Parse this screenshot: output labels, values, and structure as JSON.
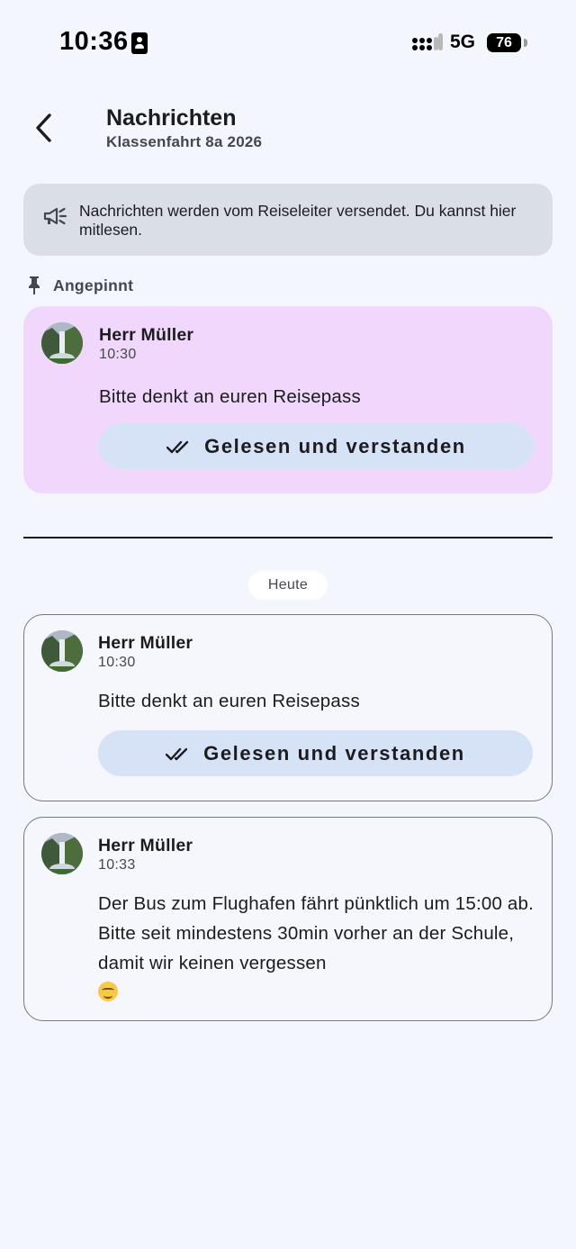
{
  "status_bar": {
    "time": "10:36",
    "network": "5G",
    "battery": "76",
    "icons": [
      "id-card-icon",
      "signal-icon",
      "battery-icon"
    ]
  },
  "header": {
    "title": "Nachrichten",
    "subtitle": "Klassenfahrt 8a 2026",
    "back_icon": "chevron-left-icon"
  },
  "info_banner": {
    "icon": "megaphone-icon",
    "text": "Nachrichten werden vom Reiseleiter versendet. Du kannst hier mitlesen."
  },
  "pinned": {
    "label": "Angepinnt",
    "icon": "pin-icon",
    "message": {
      "sender": "Herr Müller",
      "time": "10:30",
      "text": "Bitte denkt an euren Reisepass",
      "ack_label": "Gelesen und verstanden"
    }
  },
  "date_separator": "Heute",
  "messages": [
    {
      "sender": "Herr Müller",
      "time": "10:30",
      "text": "Bitte denkt an euren Reisepass",
      "ack_label": "Gelesen und verstanden"
    },
    {
      "sender": "Herr Müller",
      "time": "10:33",
      "text": "Der Bus zum Flughafen fährt pünktlich um 15:00 ab. Bitte seit mindestens 30min vorher an der Schule, damit wir keinen vergessen"
    }
  ],
  "colors": {
    "background": "#f4f6fd",
    "pinned_card": "#f1d7fb",
    "ack_button": "#d6e3f7",
    "banner": "#dadfe7"
  }
}
